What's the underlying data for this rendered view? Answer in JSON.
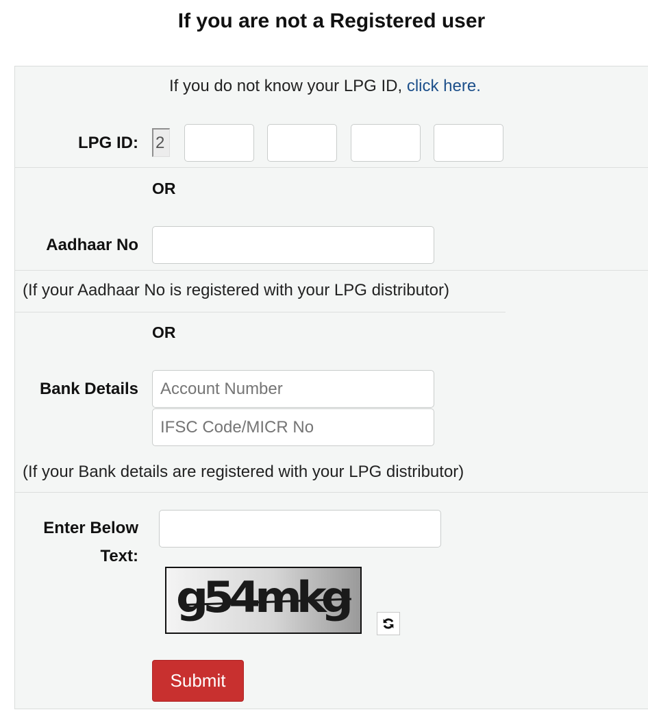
{
  "page": {
    "title": "If you are not a Registered user"
  },
  "lpg_help": {
    "text": "If you do not know your LPG ID, ",
    "link": "click here."
  },
  "lpg_id": {
    "label": "LPG ID:",
    "prefix": "2",
    "fields": [
      "",
      "",
      "",
      ""
    ]
  },
  "or_1": "OR",
  "aadhaar": {
    "label": "Aadhaar No",
    "value": "",
    "note": "(If your Aadhaar No is registered with your LPG distributor)"
  },
  "or_2": "OR",
  "bank": {
    "label": "Bank Details",
    "account_placeholder": "Account Number",
    "ifsc_placeholder": "IFSC Code/MICR No",
    "note": "(If your Bank details are registered with your LPG distributor)"
  },
  "captcha": {
    "label_line1": "Enter Below",
    "label_line2": "Text:",
    "value": "",
    "image_text": "g54mkg",
    "refresh_icon": "refresh-icon"
  },
  "submit": {
    "label": "Submit",
    "color": "#c8302f"
  },
  "colors": {
    "link": "#1c4f8a",
    "panel_bg": "#f4f6f5"
  }
}
